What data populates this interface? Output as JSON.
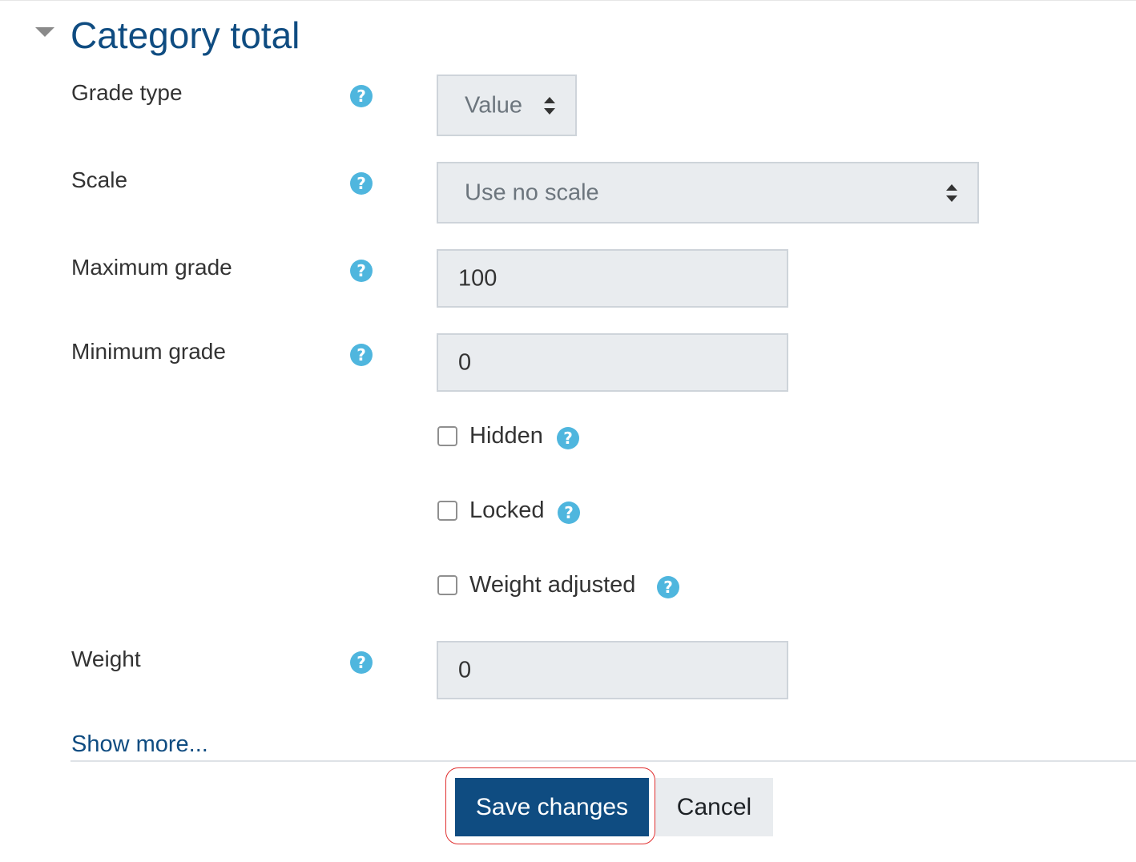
{
  "section": {
    "title": "Category total"
  },
  "fields": {
    "grade_type": {
      "label": "Grade type",
      "value": "Value",
      "help_icon": "question-circle-icon"
    },
    "scale": {
      "label": "Scale",
      "value": "Use no scale",
      "help_icon": "question-circle-icon"
    },
    "maximum_grade": {
      "label": "Maximum grade",
      "value": "100",
      "help_icon": "question-circle-icon"
    },
    "minimum_grade": {
      "label": "Minimum grade",
      "value": "0",
      "help_icon": "question-circle-icon"
    },
    "hidden": {
      "label": "Hidden",
      "checked": false
    },
    "locked": {
      "label": "Locked",
      "checked": false
    },
    "weight_adjusted": {
      "label": "Weight adjusted",
      "checked": false
    },
    "weight": {
      "label": "Weight",
      "value": "0",
      "help_icon": "question-circle-icon"
    }
  },
  "help_glyph": "?",
  "show_more_label": "Show more...",
  "buttons": {
    "save_label": "Save changes",
    "cancel_label": "Cancel"
  },
  "colors": {
    "accent": "#0f4c81",
    "help_icon": "#4fb6de",
    "input_bg": "#e9ecef",
    "focus_ring": "#e03030"
  }
}
